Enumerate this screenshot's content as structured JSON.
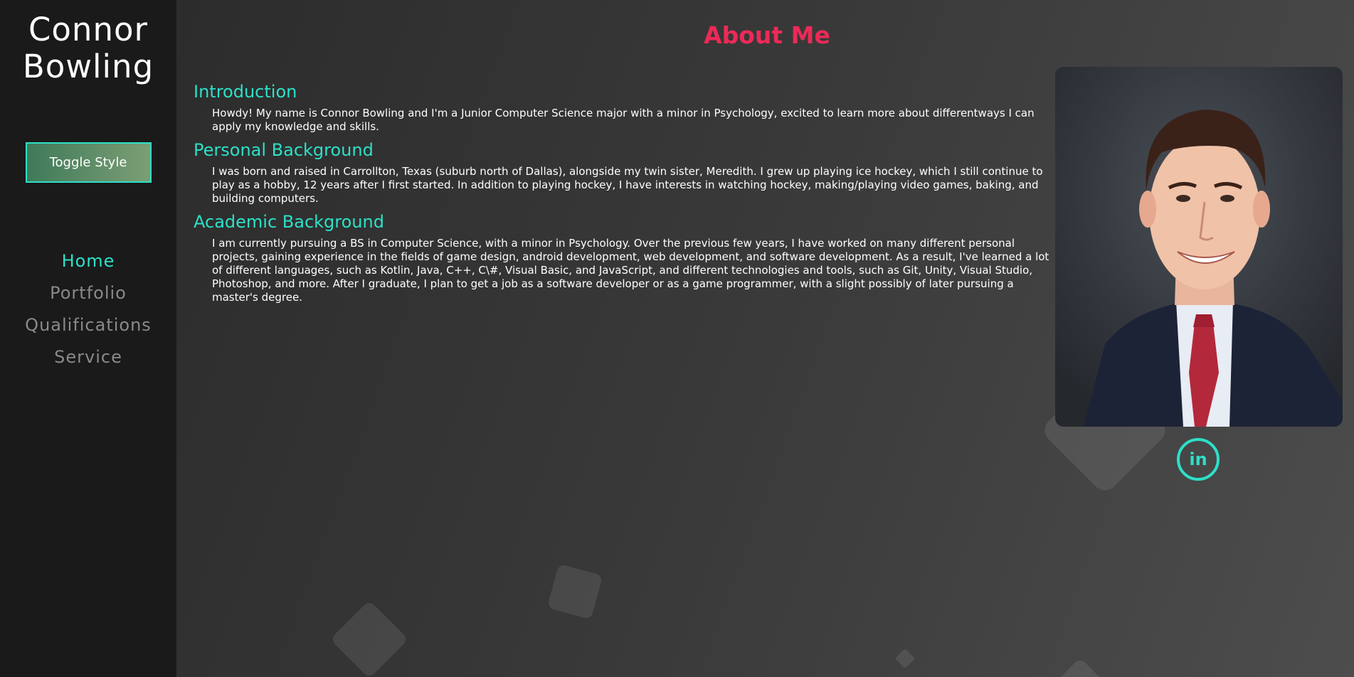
{
  "sidebar": {
    "name_line1": "Connor",
    "name_line2": "Bowling",
    "toggle_label": "Toggle Style",
    "nav": [
      {
        "label": "Home",
        "active": true
      },
      {
        "label": "Portfolio",
        "active": false
      },
      {
        "label": "Qualifications",
        "active": false
      },
      {
        "label": "Service",
        "active": false
      }
    ]
  },
  "main": {
    "title": "About Me",
    "sections": [
      {
        "heading": "Introduction",
        "text": "Howdy! My name is Connor Bowling and I'm a Junior Computer Science major with a minor in Psychology, excited to learn more about differentways I can apply my knowledge and skills."
      },
      {
        "heading": "Personal Background",
        "text": "I was born and raised in Carrollton, Texas (suburb north of Dallas), alongside my twin sister, Meredith. I grew up playing ice hockey, which I still continue to play as a hobby, 12 years after I first started. In addition to playing hockey, I have interests in watching hockey, making/playing video games, baking, and building computers."
      },
      {
        "heading": "Academic Background",
        "text": "I am currently pursuing a BS in Computer Science, with a minor in Psychology. Over the previous few years, I have worked on many different personal projects, gaining experience in the fields of game design, android development, web development, and software development. As a result, I've learned a lot of different languages, such as Kotlin, Java, C++, C\\#, Visual Basic, and JavaScript, and different technologies and tools, such as Git, Unity, Visual Studio, Photoshop, and more. After I graduate, I plan to get a job as a software developer or as a game programmer, with a slight possibly of later pursuing a master's degree."
      }
    ],
    "linkedin_label": "in"
  },
  "colors": {
    "accent": "#2de0c8",
    "title": "#ec2a58",
    "sidebar_bg": "#1a1a1a"
  },
  "icons": {
    "linkedin": "linkedin-icon",
    "portrait": "profile-photo"
  }
}
